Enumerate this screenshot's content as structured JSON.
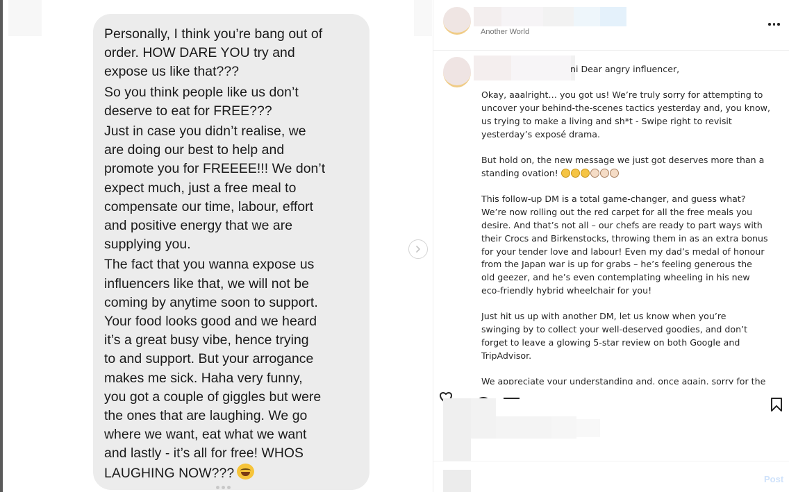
{
  "image": {
    "message_lines": [
      "Personally, I think you’re bang out of",
      "order. HOW DARE YOU try and",
      "expose us like that???",
      "So you think people like us don’t",
      "deserve to eat for FREE???",
      "Just in case you didn’t realise, we",
      "are doing our best to help and",
      "promote you for FREEEE!!! We don’t",
      "expect much, just a free meal to",
      "compensate our time, labour, effort",
      "and positive energy that we are",
      "supplying you.",
      "The fact that you wanna expose us",
      "influencers like that, we will not be",
      "coming by anytime soon to support.",
      "Your food looks good and we heard",
      "it’s a great busy vibe, hence trying",
      "to and support. But your arrogance",
      "makes me sick. Haha very funny,",
      "you got a couple of giggles but were",
      "the ones that are laughing. We go",
      "where we want, eat what we want",
      "and lastly - it’s all for free! WHOS",
      "LAUGHING NOW???"
    ],
    "laugh_emoji": "laughing-emoji",
    "carousel_dots": 3
  },
  "header": {
    "subtitle": "Another World"
  },
  "caption": {
    "greeting": "ni Dear angry influencer,",
    "p1": "Okay, aaalright… you got us! We’re truly sorry for attempting to\nuncover your behind-the-scenes tactics yesterday and, you know,\nus trying to make a living and sh*t - Swipe right to revisit\nyesterday’s exposé drama.",
    "p2": "But hold on, the new message we just got deserves more than a\nstanding ovation!",
    "p3": "This follow-up DM is a total game-changer, and guess what?\nWe’re now rolling out the red carpet for all the free meals you\ndesire. And that’s not all – our chefs are ready to part ways with\ntheir Crocs and Birkenstocks, throwing them in as an extra bonus\nfor your tender love and labour! Even my dad’s medal of honour\nfrom the Japan war is up for grabs – he’s feeling generous the\nold geezer, and he’s even contemplating wheeling in his new\neco-friendly hybrid wheelchair for you!",
    "p4": "Just hit us up with another DM, let us know when you’re\nswinging by to collect your well-deserved goodies, and don’t\nforget to leave a glowing 5-star review on both Google and\nTripAdvisor.",
    "p5": "We appreciate your understanding and, once again, sorry for the",
    "emojis": [
      "laughing-emoji",
      "laughing-emoji",
      "laughing-emoji",
      "clapping-emoji",
      "clapping-emoji",
      "clapping-emoji"
    ]
  },
  "comment": {
    "post_label": "Post"
  },
  "colors": {
    "bubble": "#ececec",
    "post_disabled": "#cfe2fb",
    "avatar_ring": "#f0cc86"
  }
}
